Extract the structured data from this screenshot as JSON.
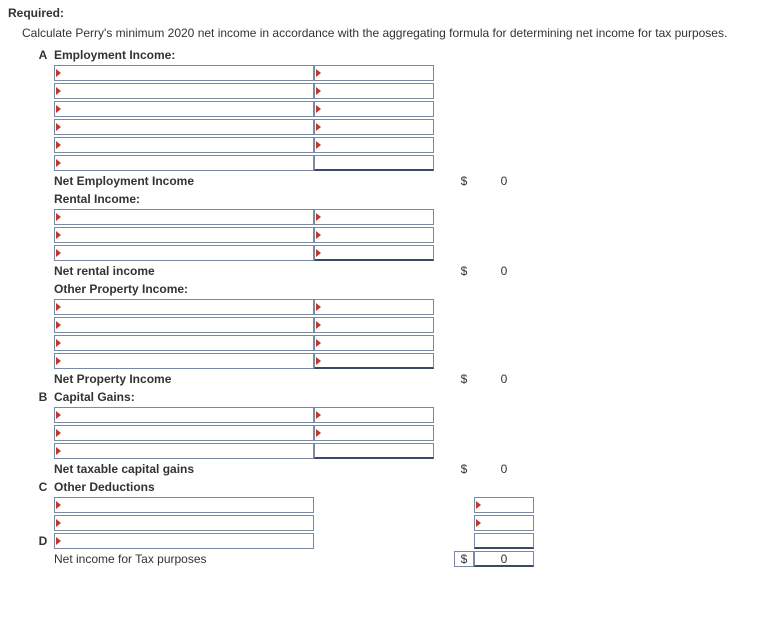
{
  "header": {
    "required_label": "Required:",
    "intro": "Calculate Perry's minimum 2020 net income in accordance with the aggregating formula for determining net income for tax purposes."
  },
  "sections": {
    "A": {
      "letter": "A",
      "title": "Employment Income:",
      "net_label": "Net Employment Income",
      "net_currency": "$",
      "net_value": "0",
      "sub1": {
        "title": "Rental Income:",
        "net_label": "Net rental income",
        "net_currency": "$",
        "net_value": "0"
      },
      "sub2": {
        "title": "Other Property Income:",
        "net_label": "Net Property Income",
        "net_currency": "$",
        "net_value": "0"
      }
    },
    "B": {
      "letter": "B",
      "title": "Capital Gains:",
      "net_label": "Net taxable capital gains",
      "net_currency": "$",
      "net_value": "0"
    },
    "C": {
      "letter": "C",
      "title": "Other Deductions"
    },
    "D": {
      "letter": "D",
      "net_label": "Net income for Tax purposes",
      "net_currency": "$",
      "net_value": "0"
    }
  }
}
